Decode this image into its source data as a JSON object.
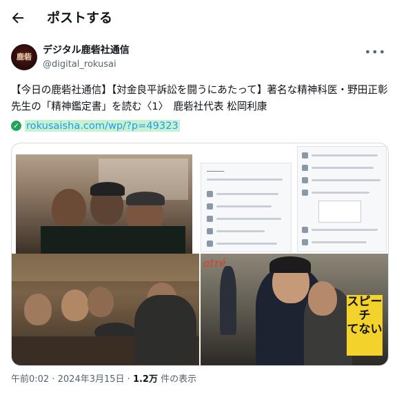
{
  "header": {
    "title": "ポストする"
  },
  "author": {
    "name": "デジタル鹿砦社通信",
    "handle": "@digital_rokusai",
    "avatar_text": "鹿砦"
  },
  "tweet": {
    "text": "【今日の鹿砦社通信】【対金良平訴訟を闘うにあたって】著名な精神科医・野田正彰先生の「精神鑑定書」を読む〈1〉　鹿砦社代表 松岡利康",
    "link": "rokusaisha.com/wp/?p=49323"
  },
  "media": {
    "sign_text_1": "スピーチ",
    "sign_text_2": "てない",
    "store_sign": "atré"
  },
  "meta": {
    "time": "午前0:02",
    "dot": "·",
    "date": "2024年3月15日",
    "views": "1.2万",
    "views_suffix": "件の表示"
  },
  "icons": {
    "back": "arrow-left-icon",
    "more": "more-horizontal-icon",
    "verified": "check-circle-icon"
  }
}
